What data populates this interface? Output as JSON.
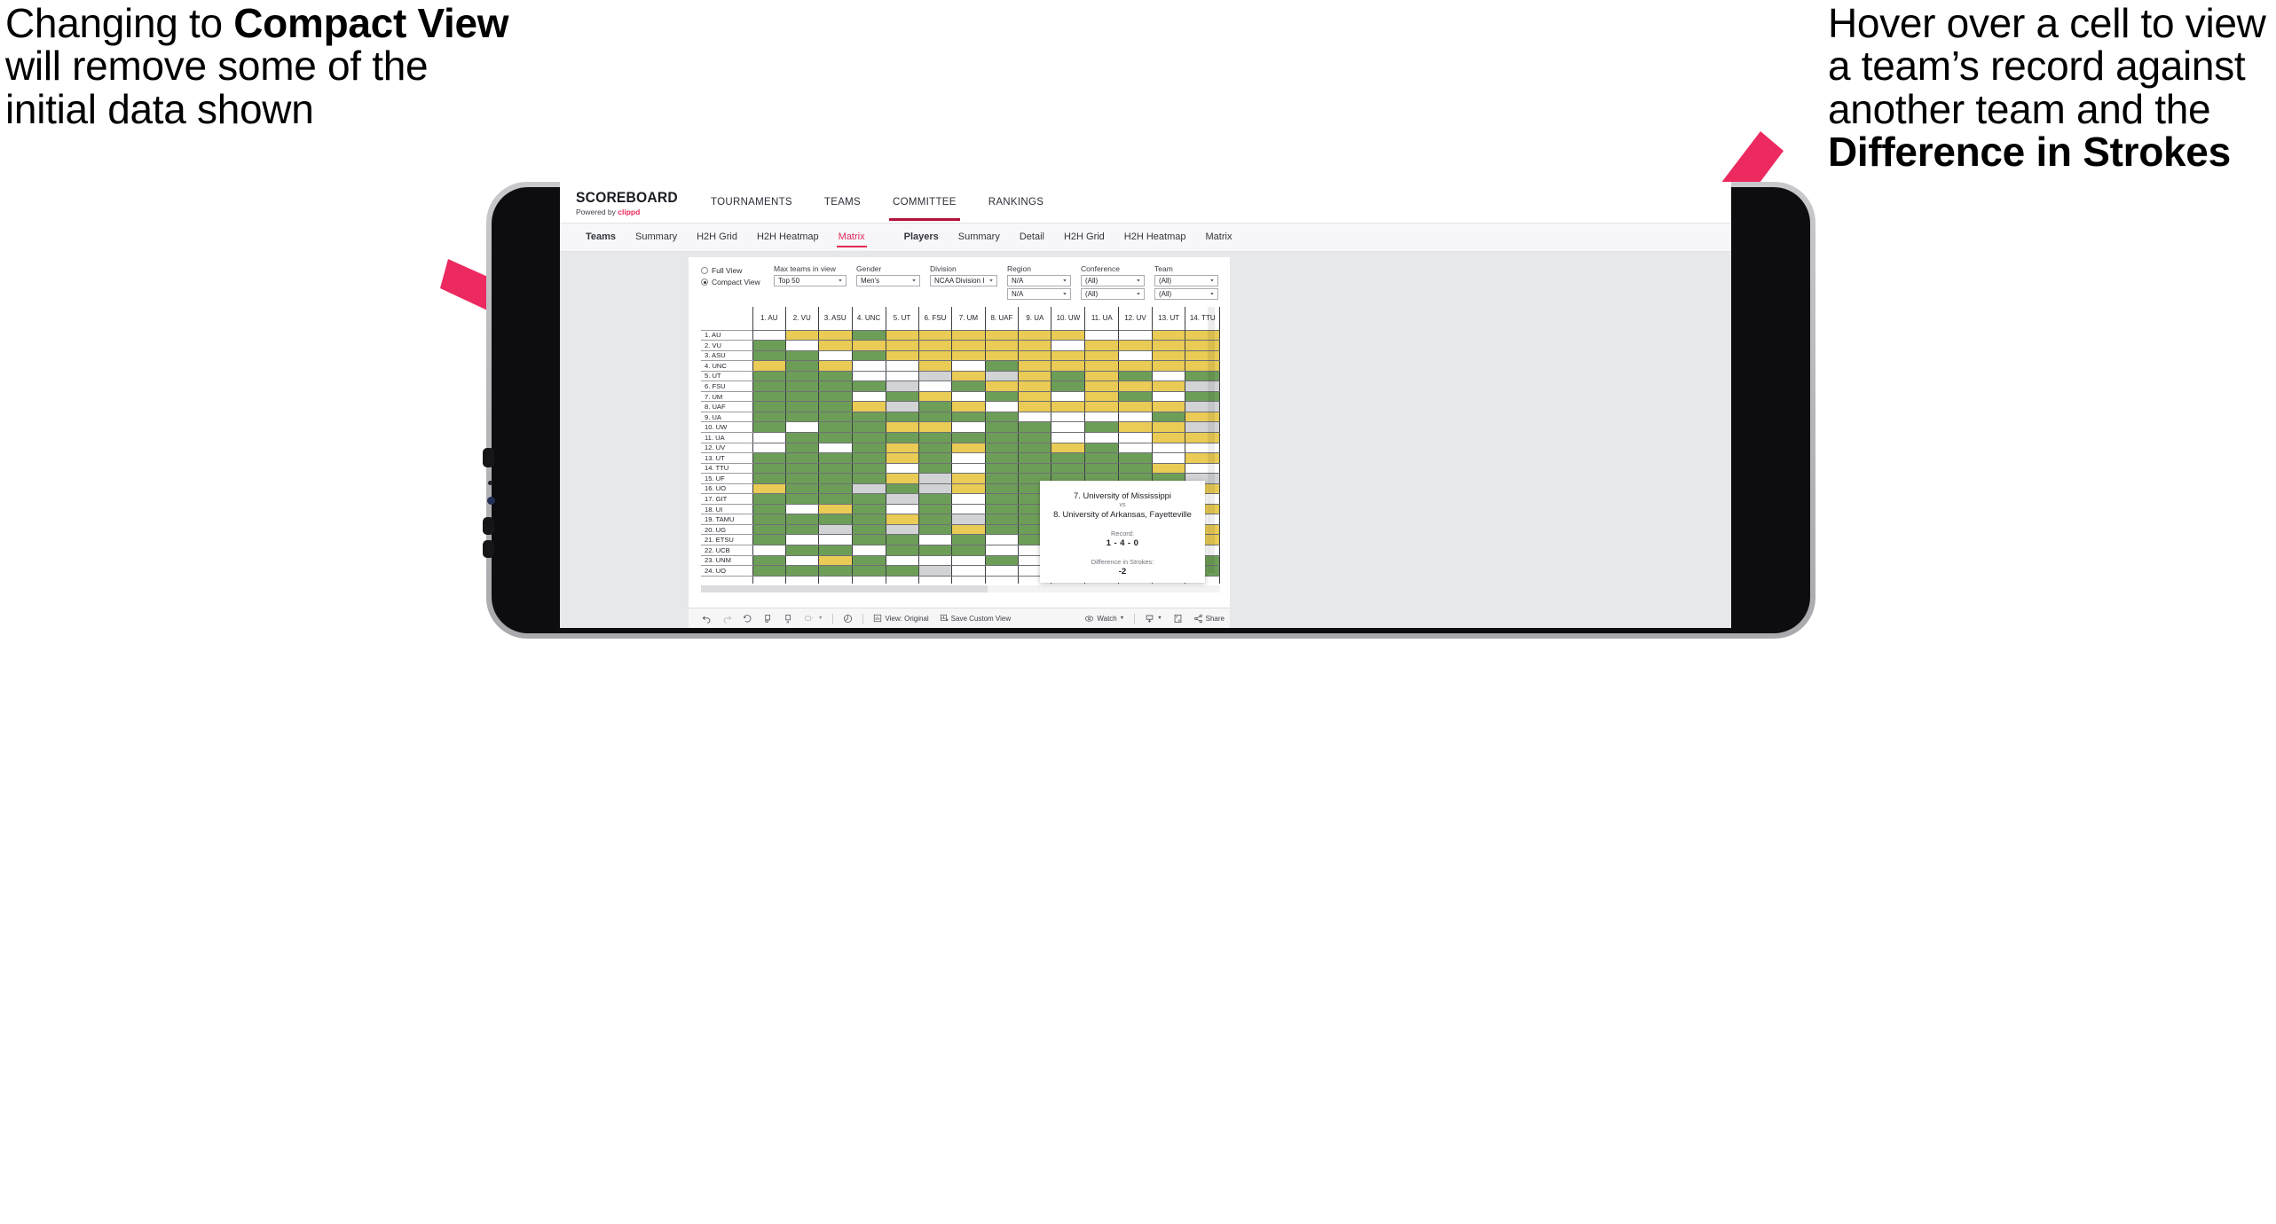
{
  "annotations": {
    "left": {
      "pre": "Changing to ",
      "bold": "Compact View",
      "post": " will remove some of the initial data shown"
    },
    "right": {
      "pre": "Hover over a cell to view a team’s record against another team and the ",
      "bold": "Difference in Strokes",
      "post": ""
    },
    "accent_color": "#ec2a60"
  },
  "app": {
    "brand": {
      "name": "SCOREBOARD",
      "tagline_pre": "Powered by ",
      "tagline_brand": "clippd"
    },
    "topnav": [
      {
        "label": "TOURNAMENTS",
        "active": false
      },
      {
        "label": "TEAMS",
        "active": false
      },
      {
        "label": "COMMITTEE",
        "active": true
      },
      {
        "label": "RANKINGS",
        "active": false
      }
    ],
    "subnav_teams": [
      {
        "label": "Teams",
        "head": true,
        "selected": false
      },
      {
        "label": "Summary",
        "head": false,
        "selected": false
      },
      {
        "label": "H2H Grid",
        "head": false,
        "selected": false
      },
      {
        "label": "H2H Heatmap",
        "head": false,
        "selected": false
      },
      {
        "label": "Matrix",
        "head": false,
        "selected": true
      }
    ],
    "subnav_players": [
      {
        "label": "Players",
        "head": true,
        "selected": false
      },
      {
        "label": "Summary",
        "head": false,
        "selected": false
      },
      {
        "label": "Detail",
        "head": false,
        "selected": false
      },
      {
        "label": "H2H Grid",
        "head": false,
        "selected": false
      },
      {
        "label": "H2H Heatmap",
        "head": false,
        "selected": false
      },
      {
        "label": "Matrix",
        "head": false,
        "selected": false
      }
    ]
  },
  "filters": {
    "view_mode": {
      "full_label": "Full View",
      "compact_label": "Compact View",
      "selected": "Compact View"
    },
    "max_teams": {
      "label": "Max teams in view",
      "value": "Top 50"
    },
    "gender": {
      "label": "Gender",
      "value": "Men's"
    },
    "division": {
      "label": "Division",
      "value": "NCAA Division I"
    },
    "region": {
      "label": "Region",
      "value1": "N/A",
      "value2": "N/A"
    },
    "conference": {
      "label": "Conference",
      "value1": "(All)",
      "value2": "(All)"
    },
    "team": {
      "label": "Team",
      "value1": "(All)",
      "value2": "(All)"
    }
  },
  "tooltip": {
    "team_a": "7. University of Mississippi",
    "vs": "vs",
    "team_b": "8. University of Arkansas, Fayetteville",
    "record_label": "Record:",
    "record_value": "1 - 4 - 0",
    "diff_label": "Difference in Strokes:",
    "diff_value": "-2"
  },
  "toolbar": {
    "view_original": "View: Original",
    "save_custom_view": "Save Custom View",
    "watch": "Watch",
    "share": "Share"
  },
  "chart_data": {
    "type": "heatmap",
    "title": "Team Head-to-Head Matrix",
    "legend": {
      "win": "#6d9e58",
      "loss": "#e9cb55",
      "tie": "#d2d3d5",
      "none": "#ffffff"
    },
    "columns": [
      "1. AU",
      "2. VU",
      "3. ASU",
      "4. UNC",
      "5. UT",
      "6. FSU",
      "7. UM",
      "8. UAF",
      "9. UA",
      "10. UW",
      "11. UA",
      "12. UV",
      "13. UT",
      "14. TTU"
    ],
    "rows": [
      "1. AU",
      "2. VU",
      "3. ASU",
      "4. UNC",
      "5. UT",
      "6. FSU",
      "7. UM",
      "8. UAF",
      "9. UA",
      "10. UW",
      "11. UA",
      "12. UV",
      "13. UT",
      "14. TTU",
      "15. UF",
      "16. UO",
      "17. GIT",
      "18. UI",
      "19. TAMU",
      "20. UG",
      "21. ETSU",
      "22. UCB",
      "23. UNM",
      "24. UO"
    ],
    "cells": [
      [
        "w",
        "y",
        "y",
        "g",
        "y",
        "y",
        "y",
        "y",
        "y",
        "y",
        "w",
        "w",
        "y",
        "y"
      ],
      [
        "g",
        "w",
        "y",
        "y",
        "y",
        "y",
        "y",
        "y",
        "y",
        "w",
        "y",
        "y",
        "y",
        "y"
      ],
      [
        "g",
        "g",
        "w",
        "g",
        "y",
        "y",
        "y",
        "y",
        "y",
        "y",
        "y",
        "w",
        "y",
        "y"
      ],
      [
        "y",
        "g",
        "y",
        "w",
        "w",
        "y",
        "w",
        "g",
        "y",
        "y",
        "y",
        "y",
        "y",
        "y"
      ],
      [
        "g",
        "g",
        "g",
        "w",
        "w",
        "a",
        "y",
        "a",
        "y",
        "g",
        "y",
        "g",
        "w",
        "g"
      ],
      [
        "g",
        "g",
        "g",
        "g",
        "a",
        "w",
        "g",
        "y",
        "y",
        "g",
        "y",
        "y",
        "y",
        "a"
      ],
      [
        "g",
        "g",
        "g",
        "w",
        "g",
        "y",
        "w",
        "g",
        "y",
        "w",
        "y",
        "g",
        "w",
        "g"
      ],
      [
        "g",
        "g",
        "g",
        "y",
        "a",
        "g",
        "y",
        "w",
        "y",
        "y",
        "y",
        "y",
        "y",
        "a"
      ],
      [
        "g",
        "g",
        "g",
        "g",
        "g",
        "g",
        "g",
        "g",
        "w",
        "w",
        "w",
        "w",
        "g",
        "y"
      ],
      [
        "g",
        "w",
        "g",
        "g",
        "y",
        "y",
        "w",
        "g",
        "g",
        "w",
        "g",
        "y",
        "y",
        "a"
      ],
      [
        "w",
        "g",
        "g",
        "g",
        "g",
        "g",
        "g",
        "g",
        "g",
        "w",
        "w",
        "w",
        "y",
        "y"
      ],
      [
        "w",
        "g",
        "w",
        "g",
        "y",
        "g",
        "y",
        "g",
        "g",
        "y",
        "g",
        "w",
        "w",
        "w"
      ],
      [
        "g",
        "g",
        "g",
        "g",
        "y",
        "g",
        "w",
        "g",
        "g",
        "g",
        "g",
        "g",
        "w",
        "y"
      ],
      [
        "g",
        "g",
        "g",
        "g",
        "w",
        "g",
        "w",
        "g",
        "g",
        "g",
        "g",
        "g",
        "y",
        "w"
      ],
      [
        "g",
        "g",
        "g",
        "g",
        "y",
        "a",
        "y",
        "g",
        "g",
        "g",
        "g",
        "g",
        "g",
        "a"
      ],
      [
        "y",
        "g",
        "g",
        "a",
        "g",
        "a",
        "y",
        "g",
        "g",
        "g",
        "g",
        "a",
        "y",
        "y"
      ],
      [
        "g",
        "g",
        "g",
        "g",
        "a",
        "g",
        "w",
        "g",
        "g",
        "g",
        "g",
        "g",
        "g",
        "w"
      ],
      [
        "g",
        "w",
        "y",
        "g",
        "w",
        "g",
        "w",
        "g",
        "g",
        "g",
        "g",
        "g",
        "w",
        "y"
      ],
      [
        "g",
        "g",
        "g",
        "g",
        "y",
        "g",
        "a",
        "g",
        "g",
        "g",
        "g",
        "g",
        "y",
        "w"
      ],
      [
        "g",
        "g",
        "a",
        "g",
        "a",
        "g",
        "y",
        "g",
        "g",
        "g",
        "g",
        "g",
        "a",
        "y"
      ],
      [
        "g",
        "w",
        "w",
        "g",
        "g",
        "w",
        "g",
        "w",
        "g",
        "w",
        "w",
        "g",
        "a",
        "y"
      ],
      [
        "w",
        "g",
        "g",
        "w",
        "g",
        "g",
        "g",
        "w",
        "w",
        "y",
        "w",
        "g",
        "g",
        "w"
      ],
      [
        "g",
        "w",
        "y",
        "g",
        "w",
        "w",
        "w",
        "g",
        "w",
        "g",
        "y",
        "w",
        "y",
        "g"
      ],
      [
        "g",
        "g",
        "g",
        "g",
        "g",
        "a",
        "w",
        "w",
        "w",
        "g",
        "y",
        "w",
        "y",
        "g"
      ]
    ]
  }
}
